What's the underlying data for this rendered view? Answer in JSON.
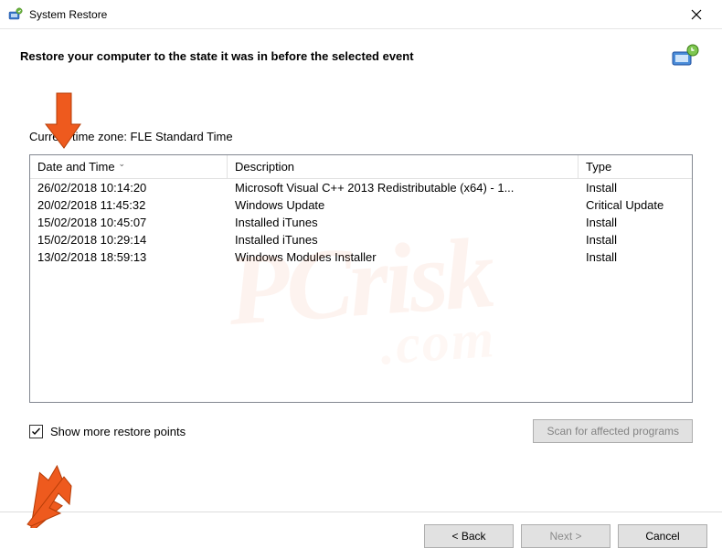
{
  "window": {
    "title": "System Restore"
  },
  "headline": "Restore your computer to the state it was in before the selected event",
  "timezone_label": "Current time zone: FLE Standard Time",
  "columns": {
    "date": "Date and Time",
    "desc": "Description",
    "type": "Type"
  },
  "rows": [
    {
      "date": "26/02/2018 10:14:20",
      "desc": "Microsoft Visual C++ 2013 Redistributable (x64) - 1...",
      "type": "Install"
    },
    {
      "date": "20/02/2018 11:45:32",
      "desc": "Windows Update",
      "type": "Critical Update"
    },
    {
      "date": "15/02/2018 10:45:07",
      "desc": "Installed iTunes",
      "type": "Install"
    },
    {
      "date": "15/02/2018 10:29:14",
      "desc": "Installed iTunes",
      "type": "Install"
    },
    {
      "date": "13/02/2018 18:59:13",
      "desc": "Windows Modules Installer",
      "type": "Install"
    }
  ],
  "show_more_label": "Show more restore points",
  "show_more_checked": true,
  "scan_button": "Scan for affected programs",
  "buttons": {
    "back": "< Back",
    "next": "Next >",
    "cancel": "Cancel"
  },
  "watermark": {
    "line1": "PCrisk",
    "line2": ".com"
  }
}
